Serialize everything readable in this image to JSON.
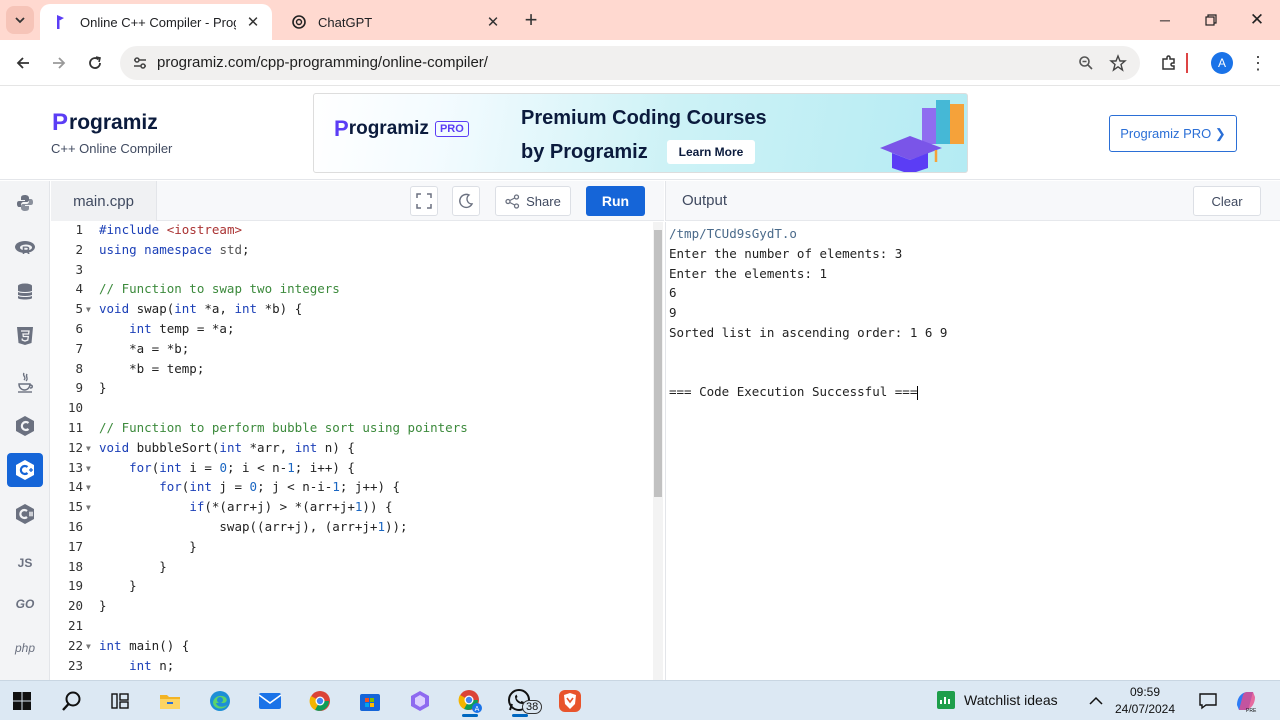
{
  "browser": {
    "tabs": [
      {
        "title": "Online C++ Compiler - Programiz",
        "active": true
      },
      {
        "title": "ChatGPT",
        "active": false
      }
    ],
    "url": "programiz.com/cpp-programming/online-compiler/",
    "profile_initial": "A"
  },
  "site": {
    "logo_text": "rogramiz",
    "logo_initial": "P",
    "subtitle": "C++ Online Compiler",
    "banner": {
      "logo_text": "rogramiz",
      "logo_initial": "P",
      "pro_badge": "PRO",
      "headline1": "Premium Coding Courses",
      "headline2": "by Programiz",
      "cta": "Learn More"
    },
    "pro_button": "Programiz PRO ❯"
  },
  "sidebar": {
    "items": [
      {
        "name": "python",
        "label": ""
      },
      {
        "name": "r",
        "label": ""
      },
      {
        "name": "sql",
        "label": ""
      },
      {
        "name": "html",
        "label": ""
      },
      {
        "name": "java",
        "label": ""
      },
      {
        "name": "c",
        "label": ""
      },
      {
        "name": "cpp",
        "label": "",
        "selected": true
      },
      {
        "name": "csharp",
        "label": ""
      },
      {
        "name": "js",
        "label": "JS"
      },
      {
        "name": "go",
        "label": "GO"
      },
      {
        "name": "php",
        "label": "php"
      }
    ]
  },
  "editor": {
    "file_tab": "main.cpp",
    "share_label": "Share",
    "run_label": "Run",
    "lines": [
      {
        "n": "1",
        "t": "#include <iostream>"
      },
      {
        "n": "2",
        "t": "using namespace std;"
      },
      {
        "n": "3",
        "t": ""
      },
      {
        "n": "4",
        "t": "// Function to swap two integers"
      },
      {
        "n": "5",
        "t": "void swap(int *a, int *b) {",
        "fold": true
      },
      {
        "n": "6",
        "t": "    int temp = *a;"
      },
      {
        "n": "7",
        "t": "    *a = *b;"
      },
      {
        "n": "8",
        "t": "    *b = temp;"
      },
      {
        "n": "9",
        "t": "}"
      },
      {
        "n": "10",
        "t": ""
      },
      {
        "n": "11",
        "t": "// Function to perform bubble sort using pointers"
      },
      {
        "n": "12",
        "t": "void bubbleSort(int *arr, int n) {",
        "fold": true
      },
      {
        "n": "13",
        "t": "    for(int i = 0; i < n-1; i++) {",
        "fold": true
      },
      {
        "n": "14",
        "t": "        for(int j = 0; j < n-i-1; j++) {",
        "fold": true
      },
      {
        "n": "15",
        "t": "            if(*(arr+j) > *(arr+j+1)) {",
        "fold": true
      },
      {
        "n": "16",
        "t": "                swap((arr+j), (arr+j+1));"
      },
      {
        "n": "17",
        "t": "            }"
      },
      {
        "n": "18",
        "t": "        }"
      },
      {
        "n": "19",
        "t": "    }"
      },
      {
        "n": "20",
        "t": "}"
      },
      {
        "n": "21",
        "t": ""
      },
      {
        "n": "22",
        "t": "int main() {",
        "fold": true
      },
      {
        "n": "23",
        "t": "    int n;"
      }
    ]
  },
  "output": {
    "title": "Output",
    "clear_label": "Clear",
    "lines": [
      "/tmp/TCUd9sGydT.o",
      "Enter the number of elements: 3",
      "Enter the elements: 1",
      "6",
      "9",
      "Sorted list in ascending order: 1 6 9",
      "",
      "",
      "=== Code Execution Successful ==="
    ]
  },
  "taskbar": {
    "whatsapp_badge": "38",
    "watchlist": "Watchlist ideas",
    "time": "09:59",
    "date": "24/07/2024"
  },
  "colors": {
    "accent": "#1565d8",
    "brand": "#5b3df5",
    "tabbar": "#ffd9d0"
  }
}
